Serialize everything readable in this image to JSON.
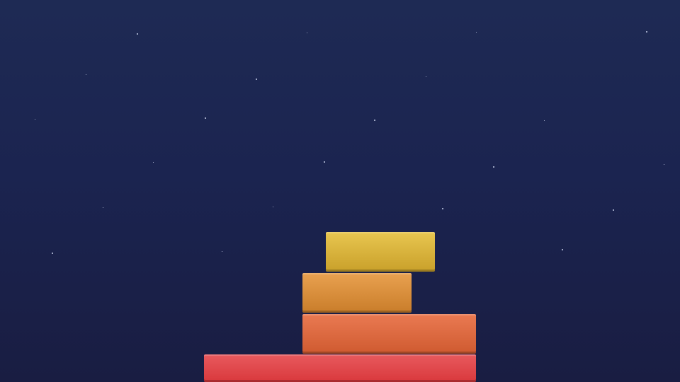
{
  "game": {
    "stacked_blocks": [
      {
        "name": "block-1",
        "color_top": "#e85a5e",
        "color_bottom": "#d9383c"
      },
      {
        "name": "block-2",
        "color_top": "#ea7a52",
        "color_bottom": "#cf5a30"
      },
      {
        "name": "block-3",
        "color_top": "#e9a150",
        "color_bottom": "#c97d2a"
      },
      {
        "name": "block-4-moving",
        "color_top": "#e8c650",
        "color_bottom": "#c9a02a"
      }
    ]
  }
}
